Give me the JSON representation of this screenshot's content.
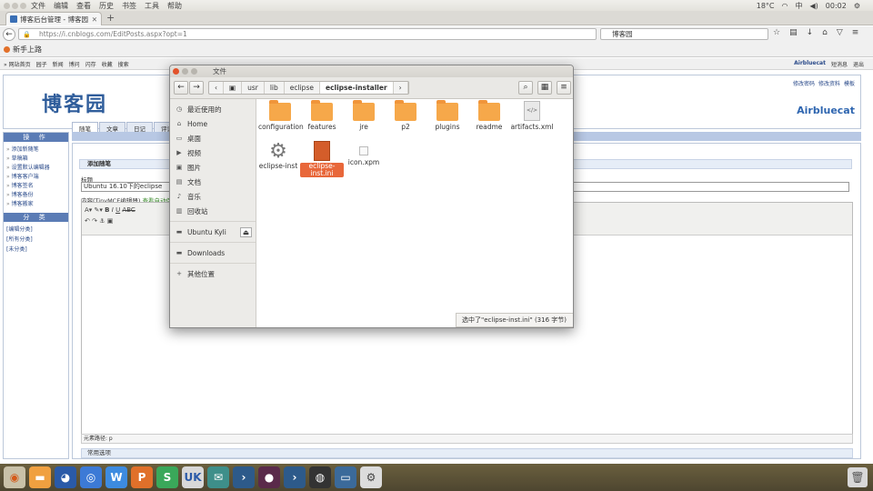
{
  "system_bar": {
    "menus": [
      "文件",
      "编辑",
      "查看",
      "历史",
      "书签",
      "工具",
      "帮助"
    ],
    "temperature": "18°C",
    "time": "00:02"
  },
  "browser": {
    "tab_title": "博客后台管理 - 博客园",
    "url": "https://i.cnblogs.com/EditPosts.aspx?opt=1",
    "search_value": "博客园",
    "bookmark": "新手上路"
  },
  "site": {
    "topnav_left": [
      "» 网站首页",
      "园子",
      "新闻",
      "博问",
      "闪存",
      "收藏",
      "搜索"
    ],
    "topnav_user": "Airbluecat",
    "topnav_right": [
      "短消息",
      "退出"
    ],
    "logo": "博客园",
    "header_links": [
      "修改密码",
      "修改资料",
      "模板"
    ],
    "header_user": "Airbluecat",
    "tabs": [
      "随笔",
      "文章",
      "日记",
      "评论"
    ],
    "ops_title": "操 作",
    "ops": [
      "添加新随笔",
      "草稿箱",
      "设置默认编辑器",
      "博客客户端",
      "博客签名",
      "博客备份",
      "博客搬家"
    ],
    "cat_title": "分 类",
    "cats": [
      "[编辑分类]",
      "[所有分类]",
      "[未分类]"
    ],
    "section_title": "添加随笔",
    "title_label": "标题",
    "title_value": "Ubuntu 16.10下的eclipse",
    "content_label": "内容(TinyMCE编辑器)",
    "content_link": "查看自动保存",
    "element_path": "元素路径: p",
    "options_title": "常用选项"
  },
  "file_manager": {
    "title": "文件",
    "crumbs": [
      "usr",
      "lib",
      "eclipse",
      "eclipse-installer"
    ],
    "sidebar": [
      "最近使用的",
      "Home",
      "桌面",
      "视频",
      "图片",
      "文档",
      "音乐",
      "回收站",
      "Ubuntu Kyli",
      "Downloads",
      "其他位置"
    ],
    "files": [
      "configuration",
      "features",
      "jre",
      "p2",
      "plugins",
      "readme",
      "artifacts.xml",
      "eclipse-inst",
      "eclipse-inst.ini",
      "icon.xpm"
    ],
    "status": "选中了\"eclipse-inst.ini\" (316 字节)"
  },
  "dock": {
    "apps": [
      "ubuntu",
      "files",
      "firefox",
      "chromium",
      "wps-writer",
      "wps-presentation",
      "wps-spreadsheet",
      "uk",
      "mail",
      "terminal",
      "video",
      "terminal2",
      "webcam",
      "screenshot",
      "settings"
    ],
    "trash": "trash"
  }
}
